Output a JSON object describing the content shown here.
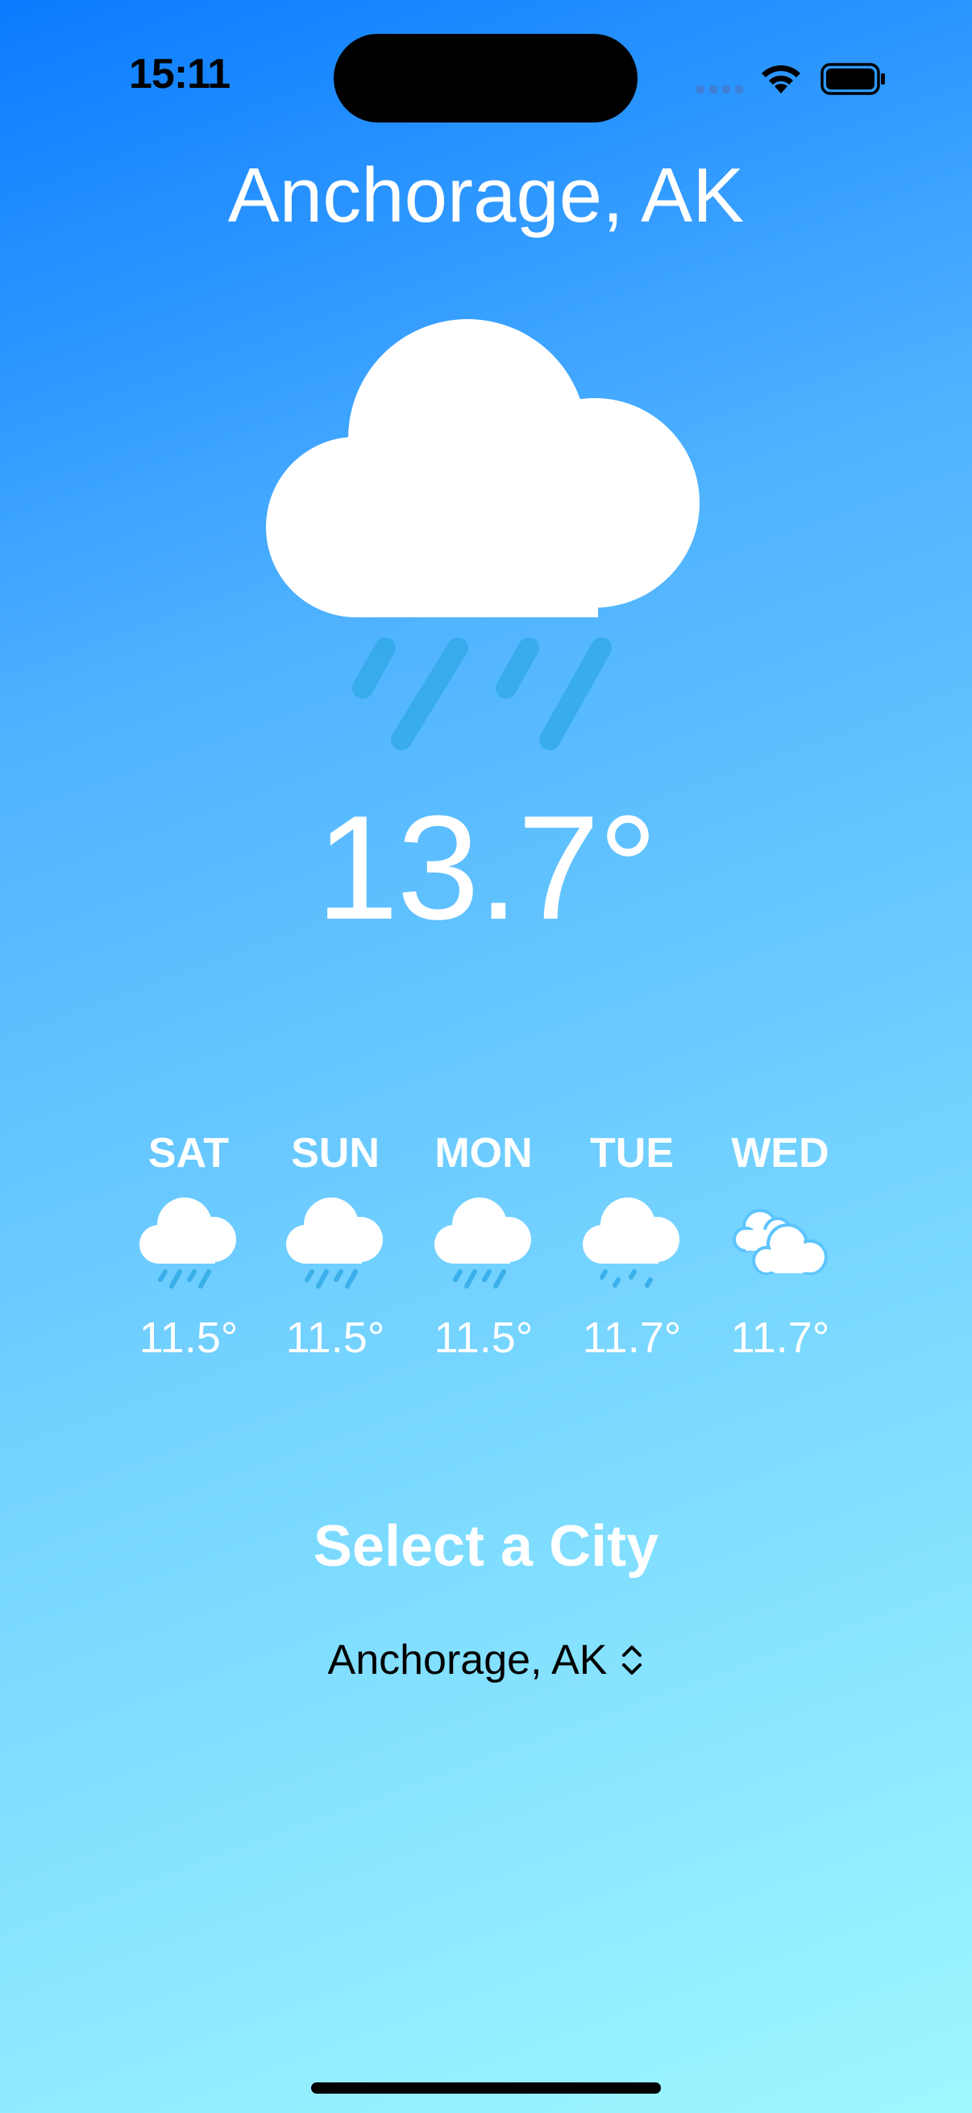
{
  "status_bar": {
    "time": "15:11"
  },
  "city_title": "Anchorage, AK",
  "current": {
    "icon": "cloud-rain-icon",
    "temperature": "13.7°"
  },
  "forecast": [
    {
      "day": "SAT",
      "icon": "cloud-rain-icon",
      "temp": "11.5°"
    },
    {
      "day": "SUN",
      "icon": "cloud-rain-icon",
      "temp": "11.5°"
    },
    {
      "day": "MON",
      "icon": "cloud-rain-icon",
      "temp": "11.5°"
    },
    {
      "day": "TUE",
      "icon": "cloud-drizzle-icon",
      "temp": "11.7°"
    },
    {
      "day": "WED",
      "icon": "clouds-icon",
      "temp": "11.7°"
    }
  ],
  "city_selector": {
    "title": "Select a City",
    "selected": "Anchorage, AK"
  },
  "colors": {
    "gradient_top": "#0a7bff",
    "gradient_bottom": "#9ef8ff",
    "text": "#ffffff",
    "rain": "#2ea8e6"
  }
}
